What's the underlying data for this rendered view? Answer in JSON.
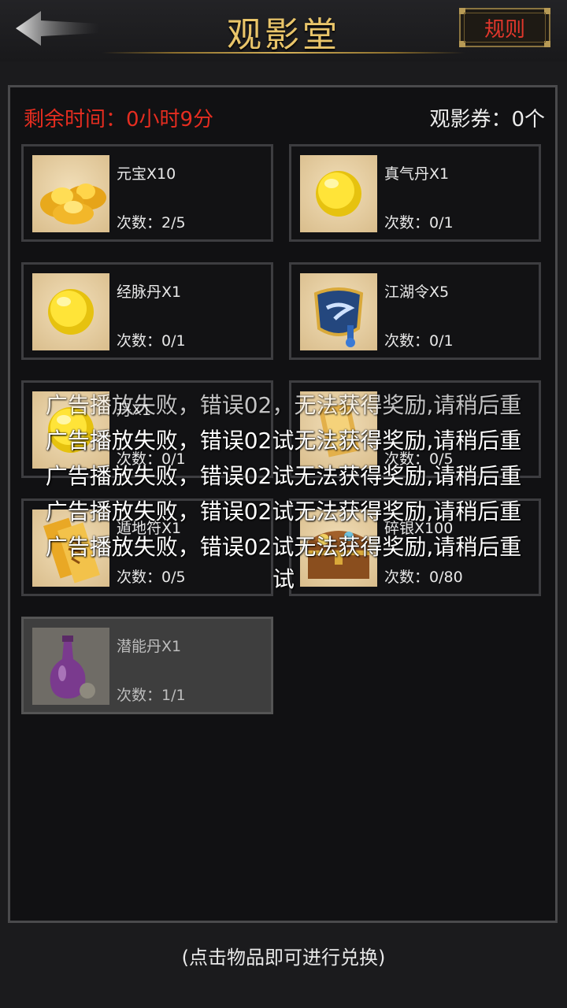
{
  "header": {
    "title": "观影堂",
    "rules_label": "规则"
  },
  "status": {
    "timer": "剩余时间：0小时9分",
    "tickets": "观影券：0个"
  },
  "items": [
    {
      "name": "元宝X10",
      "count": "次数：2/5",
      "icon": "gold-ingot-icon"
    },
    {
      "name": "真气丹X1",
      "count": "次数：0/1",
      "icon": "yellow-pill-icon"
    },
    {
      "name": "经脉丹X1",
      "count": "次数：0/1",
      "icon": "yellow-pill-icon"
    },
    {
      "name": "江湖令X5",
      "count": "次数：0/1",
      "icon": "token-pouch-icon"
    },
    {
      "name": "丹X1",
      "count": "次数：0/1",
      "icon": "yellow-pill-icon"
    },
    {
      "name": "",
      "count": "次数：0/5",
      "icon": "scroll-icon"
    },
    {
      "name": "遁地符X1",
      "count": "次数：0/5",
      "icon": "talisman-icon"
    },
    {
      "name": "碎银X100",
      "count": "次数：0/80",
      "icon": "treasure-chest-icon"
    },
    {
      "name": "潜能丹X1",
      "count": "次数：1/1",
      "icon": "potion-bottle-icon",
      "disabled": true
    }
  ],
  "toasts": [
    "广告播放失败，错误02，无法获得奖励,请稍后重",
    "广告播放失败，错误02试无法获得奖励,请稍后重",
    "广告播放失败，错误02试无法获得奖励,请稍后重",
    "广告播放失败，错误02试无法获得奖励,请稍后重",
    "广告播放失败，错误02试无法获得奖励,请稍后重",
    "试"
  ],
  "hint": "(点击物品即可进行兑换)",
  "colors": {
    "title": "#e9c56a",
    "timer": "#e52d20",
    "rules": "#e2372c"
  }
}
